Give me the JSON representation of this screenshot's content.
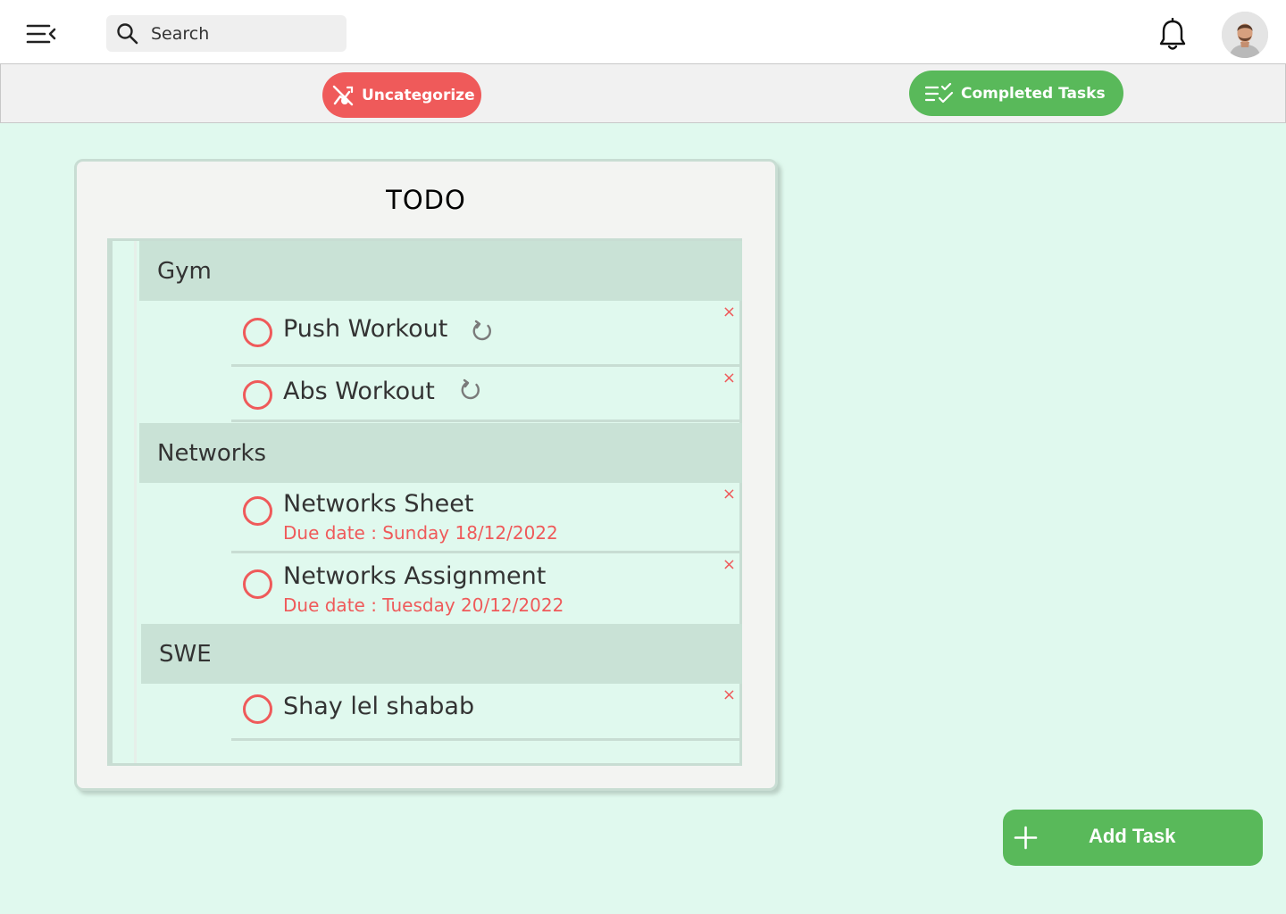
{
  "header": {
    "search_placeholder": "Search"
  },
  "filters": {
    "uncategorize_label": "Uncategorize",
    "completed_label": "Completed Tasks"
  },
  "board": {
    "title": "TODO",
    "categories": [
      {
        "name": "Gym",
        "tasks": [
          {
            "title": "Push Workout",
            "repeating": true
          },
          {
            "title": "Abs Workout",
            "repeating": true
          }
        ]
      },
      {
        "name": "Networks",
        "tasks": [
          {
            "title": "Networks Sheet",
            "due": "Due date : Sunday 18/12/2022"
          },
          {
            "title": "Networks Assignment",
            "due": "Due date : Tuesday 20/12/2022"
          }
        ]
      },
      {
        "name": "SWE",
        "tasks": [
          {
            "title": "Shay lel shabab"
          }
        ]
      }
    ],
    "close_glyph": "×"
  },
  "actions": {
    "add_task_label": "Add Task"
  },
  "colors": {
    "accent_green": "#59b95a",
    "accent_red": "#ef5a5a",
    "background": "#e0f9ee",
    "category_bg": "#c9e2d6"
  }
}
